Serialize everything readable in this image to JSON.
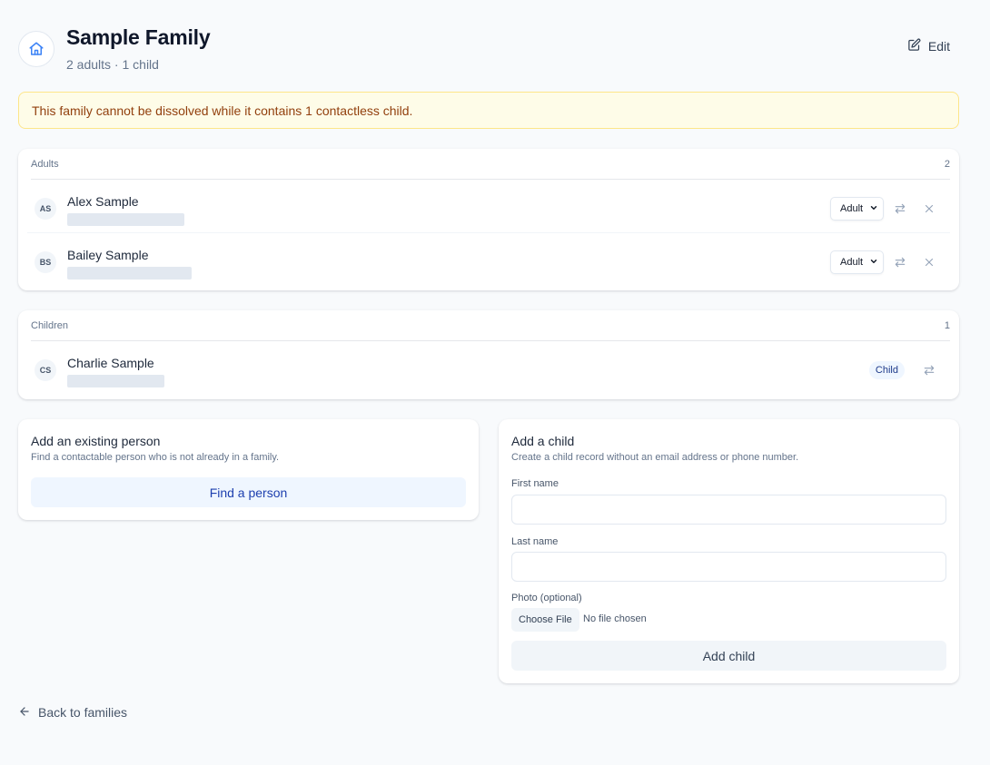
{
  "header": {
    "title": "Sample Family",
    "subtitle": "2 adults · 1 child",
    "edit_label": "Edit",
    "icons": {
      "home": "home-icon",
      "edit": "edit-icon"
    }
  },
  "alert": {
    "text": "This family cannot be dissolved while it contains 1 contactless child."
  },
  "adults": {
    "heading": "Adults",
    "count": "2",
    "members": [
      {
        "initials": "AS",
        "name": "Alex Sample",
        "role": "Adult"
      },
      {
        "initials": "BS",
        "name": "Bailey Sample",
        "role": "Adult"
      }
    ]
  },
  "children": {
    "heading": "Children",
    "count": "1",
    "members": [
      {
        "initials": "CS",
        "name": "Charlie Sample",
        "role": "Child"
      }
    ]
  },
  "add_existing": {
    "title": "Add an existing person",
    "description": "Find a contactable person who is not already in a family.",
    "button_label": "Find a person"
  },
  "add_child": {
    "title": "Add a child",
    "description": "Create a child record without an email address or phone number.",
    "first_name_label": "First name",
    "first_name_value": "",
    "last_name_label": "Last name",
    "last_name_value": "",
    "photo_label": "Photo (optional)",
    "choose_file_label": "Choose File",
    "no_file_text": "No file chosen",
    "submit_label": "Add child"
  },
  "footer": {
    "back_label": "Back to families"
  },
  "colors": {
    "page_background": "#f8fafc",
    "alert_background": "#fefce8",
    "alert_text": "#92400e",
    "accent": "#1e40af"
  }
}
